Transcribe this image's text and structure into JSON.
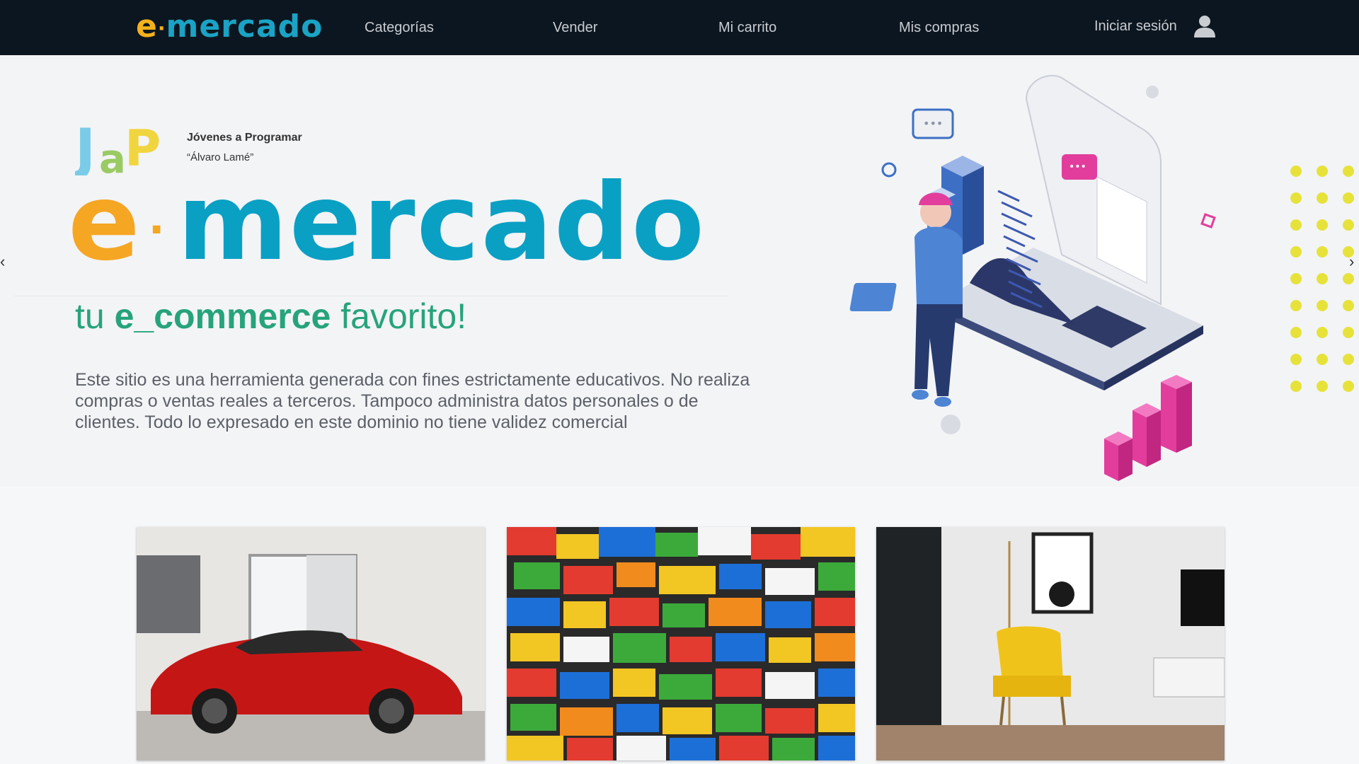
{
  "navbar": {
    "brand_e": "e",
    "brand_dot": "·",
    "brand_rest": "mercado",
    "links": [
      "Categorías",
      "Vender",
      "Mi carrito",
      "Mis compras"
    ],
    "login_label": "Iniciar sesión",
    "user_icon": "user-icon"
  },
  "hero": {
    "jap_logo_text": "JaP",
    "jap_title": "Jóvenes a Programar",
    "jap_subtitle": "“Álvaro Lamé”",
    "brand_e": "e",
    "brand_dot": "·",
    "brand_rest": "mercado",
    "tagline_pre": "tu ",
    "tagline_bold": "e_commerce",
    "tagline_post": " favorito!",
    "disclaimer": "Este sitio  es una herramienta generada con fines estrictamente educativos. No realiza compras o ventas reales a terceros. Tampoco administra datos personales o de clientes. Todo lo expresado en este dominio no tiene validez comercial",
    "carousel_prev": "‹",
    "carousel_next": "›"
  },
  "categories": [
    {
      "image": "red-sports-car"
    },
    {
      "image": "toy-bricks"
    },
    {
      "image": "yellow-armchair-living-room"
    }
  ],
  "colors": {
    "navbar_bg": "#0c1620",
    "brand_blue": "#0aa0c4",
    "brand_orange": "#f5a623",
    "tagline_green": "#27a37b",
    "accent_pink": "#e23d9c",
    "dots_yellow": "#e6e23a"
  }
}
